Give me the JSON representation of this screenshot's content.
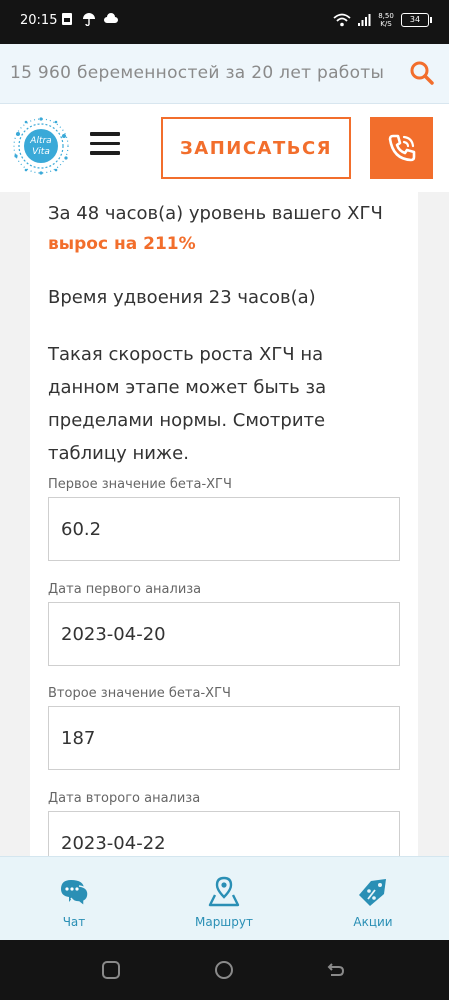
{
  "status_bar": {
    "time": "20:15",
    "net_speed_value": "8,50",
    "net_speed_unit": "K/S",
    "battery": "34"
  },
  "search": {
    "text": "15 960 беременностей за 20 лет работы"
  },
  "header": {
    "logo_line1": "Altra",
    "logo_line2": "Vita",
    "signup_label": "ЗАПИСАТЬСЯ"
  },
  "result": {
    "line1": "За 48 часов(а) уровень вашего ХГЧ",
    "growth": "вырос на 211%",
    "doubling": "Время удвоения 23 часов(а)",
    "warning": "Такая скорость роста ХГЧ на данном этапе может быть за пределами нормы. Смотрите таблицу ниже."
  },
  "form": {
    "fields": [
      {
        "label": "Первое значение бета-ХГЧ",
        "value": "60.2"
      },
      {
        "label": "Дата первого анализа",
        "value": "2023-04-20"
      },
      {
        "label": "Второе значение бета-ХГЧ",
        "value": "187"
      },
      {
        "label": "Дата второго анализа",
        "value": "2023-04-22"
      }
    ]
  },
  "bottom_nav": {
    "items": [
      {
        "label": "Чат",
        "icon": "chat-icon"
      },
      {
        "label": "Маршрут",
        "icon": "map-route-icon"
      },
      {
        "label": "Акции",
        "icon": "discount-tag-icon"
      }
    ]
  },
  "colors": {
    "accent": "#f26e2c",
    "brand_blue": "#2a8fb5"
  }
}
